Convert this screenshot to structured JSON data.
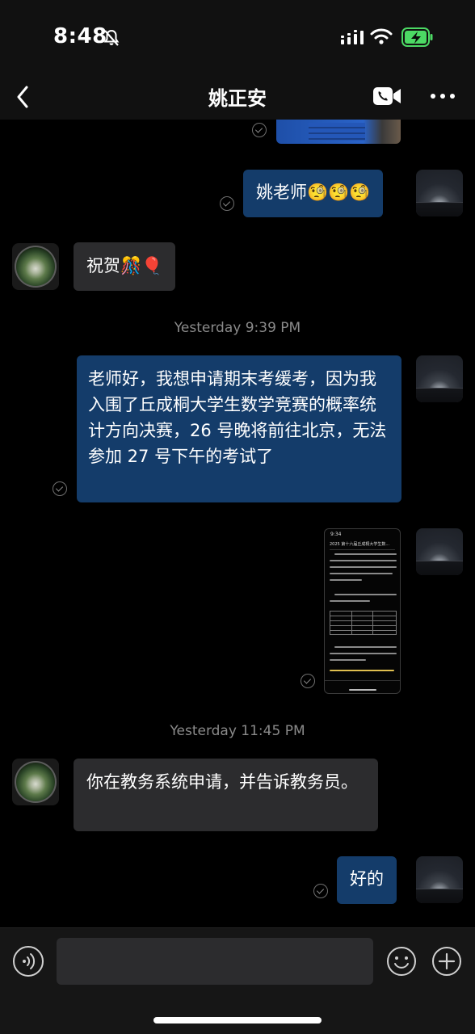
{
  "status_bar": {
    "time": "8:48",
    "icons": [
      "bell-slash-icon",
      "signal-icon",
      "wifi-icon",
      "battery-charging-icon"
    ]
  },
  "header": {
    "title": "姚正安",
    "back_icon": "chevron-left-icon",
    "video_icon": "video-call-icon",
    "more_icon": "more-icon"
  },
  "messages": [
    {
      "from": "me",
      "type": "image",
      "description_icon": "photo-icon"
    },
    {
      "from": "me",
      "type": "text",
      "text": "姚老师🧐🧐🧐"
    },
    {
      "from": "teacher",
      "type": "text",
      "text": "祝贺🎊🎈"
    },
    {
      "type": "timestamp",
      "text": "Yesterday 9:39 PM"
    },
    {
      "from": "me",
      "type": "text",
      "text": "老师好，我想申请期末考缓考，因为我入围了丘成桐大学生数学竞赛的概率统计方向决赛，26 号晚将前往北京，无法参加 27 号下午的考试了"
    },
    {
      "from": "me",
      "type": "image",
      "screenshot": {
        "time": "9:34",
        "title": "2025 第十六届丘成桐大学生数..."
      }
    },
    {
      "type": "timestamp",
      "text": "Yesterday 11:45 PM"
    },
    {
      "from": "teacher",
      "type": "text",
      "text": "你在教务系统申请，并告诉教务员。"
    },
    {
      "from": "me",
      "type": "text",
      "text": "好的"
    }
  ],
  "input_bar": {
    "placeholder": "",
    "voice_icon": "voice-input-icon",
    "emoji_icon": "emoji-icon",
    "plus_icon": "plus-icon"
  },
  "colors": {
    "outgoing_bubble": "#143c6a",
    "incoming_bubble": "#2c2c2e",
    "background": "#000000",
    "battery": "#4cd964"
  }
}
